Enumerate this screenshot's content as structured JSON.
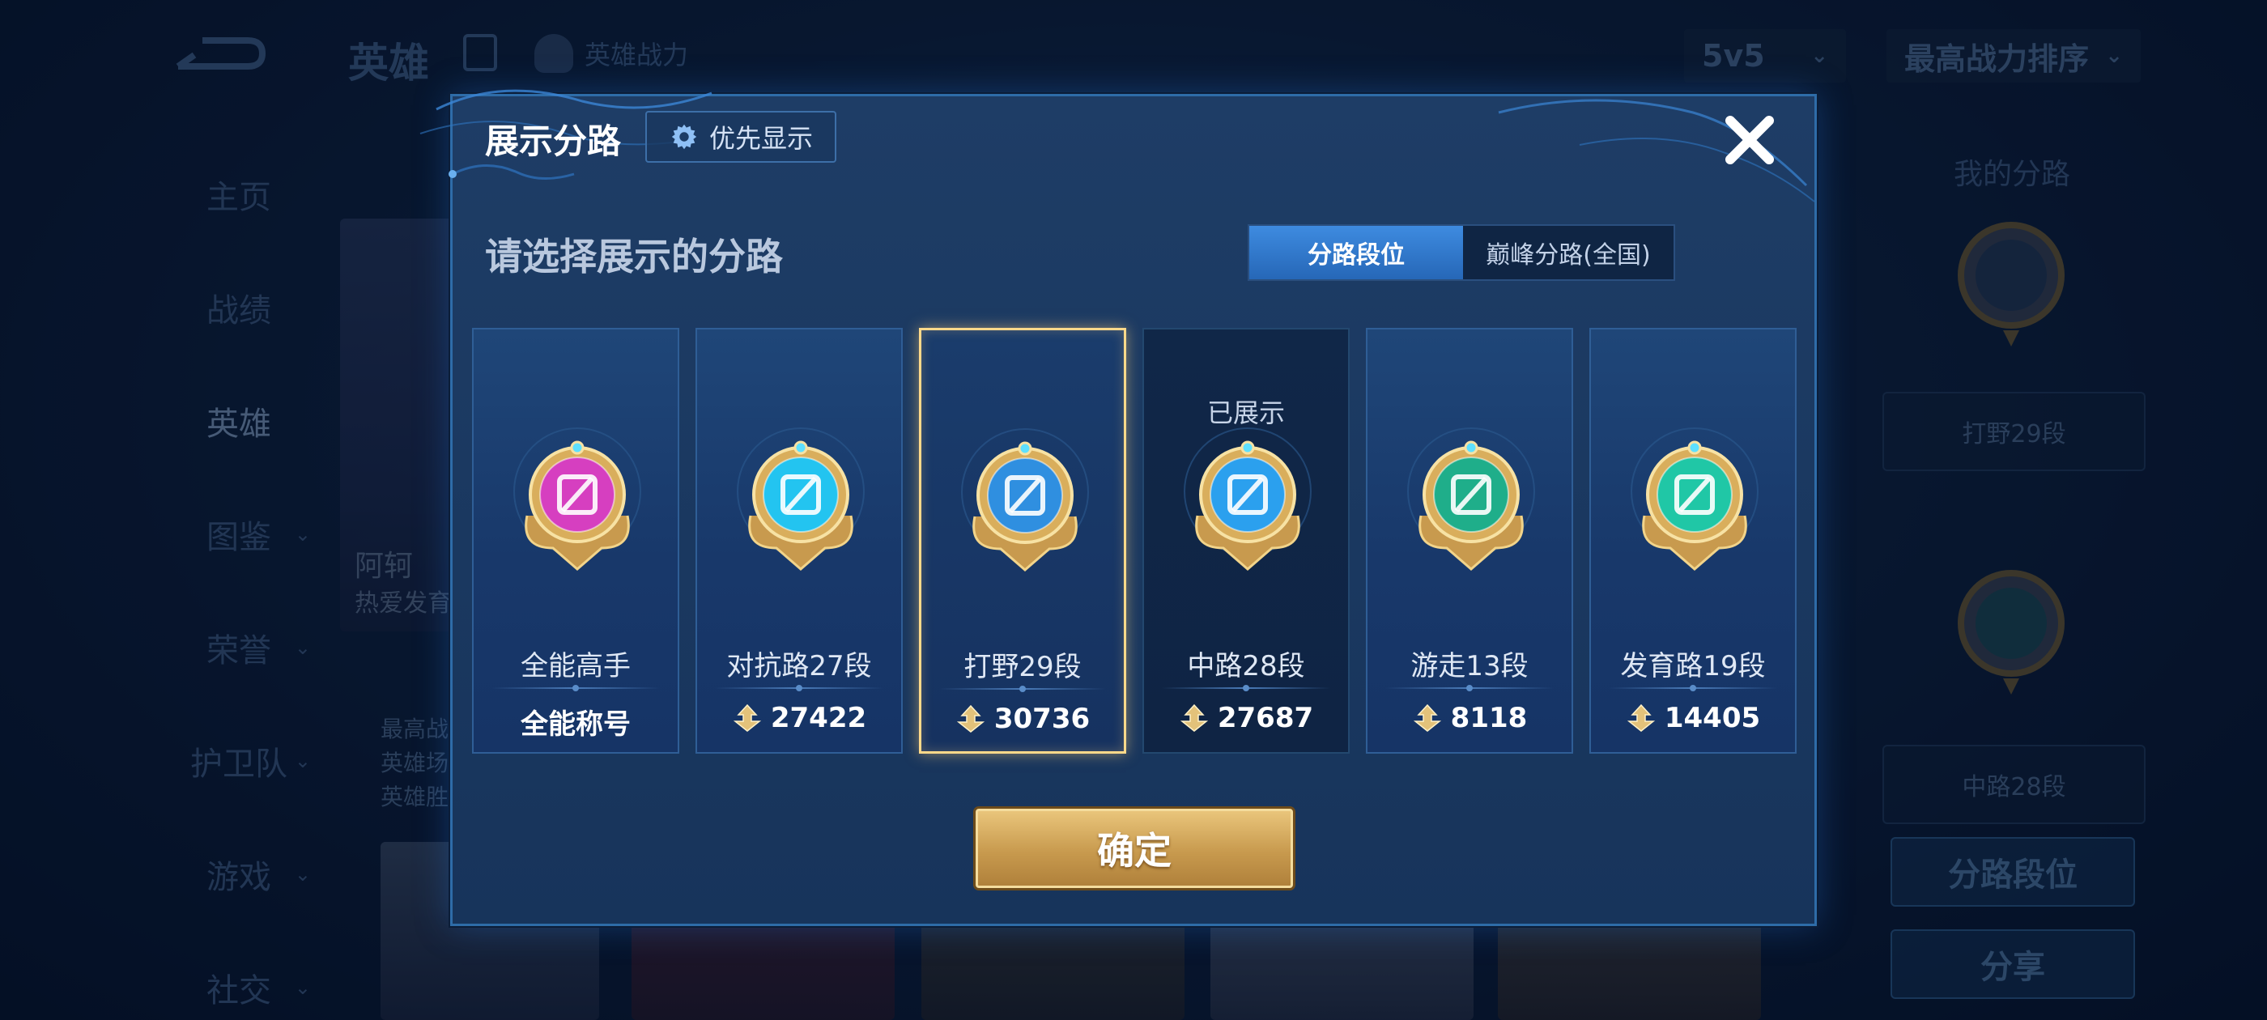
{
  "background": {
    "title": "英雄",
    "power_label": "英雄战力",
    "mode_select": "5v5",
    "sort_select": "最高战力排序",
    "nav": [
      {
        "label": "主页",
        "has_chevron": false,
        "active": false
      },
      {
        "label": "战绩",
        "has_chevron": false,
        "active": false
      },
      {
        "label": "英雄",
        "has_chevron": false,
        "active": true
      },
      {
        "label": "图鉴",
        "has_chevron": true,
        "active": false
      },
      {
        "label": "荣誉",
        "has_chevron": true,
        "active": false
      },
      {
        "label": "护卫队",
        "has_chevron": true,
        "active": false
      },
      {
        "label": "游戏",
        "has_chevron": true,
        "active": false
      },
      {
        "label": "社交",
        "has_chevron": true,
        "active": false
      }
    ],
    "hero_card_name": "阿轲",
    "hero_card_sub": "热爱发育",
    "left_stats": [
      "最高战",
      "英雄场",
      "英雄胜"
    ],
    "right_panel": {
      "title": "我的分路",
      "lane1": "打野29段",
      "lane2": "中路28段",
      "btn_lane_rank": "分路段位",
      "btn_share": "分享"
    }
  },
  "modal": {
    "title": "展示分路",
    "priority_label": "优先显示",
    "subtitle": "请选择展示的分路",
    "toggle": {
      "active": "分路段位",
      "inactive": "巅峰分路(全国)"
    },
    "confirm_label": "确定",
    "cards": [
      {
        "lane": "全能高手",
        "value": "全能称号",
        "shown": "",
        "badge": "all-rounder-badge-icon",
        "color": "#d63fc0",
        "show_power": false
      },
      {
        "lane": "对抗路27段",
        "value": "27422",
        "shown": "",
        "badge": "clash-lane-badge-icon",
        "color": "#23c4f0",
        "show_power": true
      },
      {
        "lane": "打野29段",
        "value": "30736",
        "shown": "",
        "badge": "jungle-badge-icon",
        "color": "#2f8fe0",
        "show_power": true
      },
      {
        "lane": "中路28段",
        "value": "27687",
        "shown": "已展示",
        "badge": "mid-lane-badge-icon",
        "color": "#2ba0ee",
        "show_power": true
      },
      {
        "lane": "游走13段",
        "value": "8118",
        "shown": "",
        "badge": "roam-badge-icon",
        "color": "#1fae8a",
        "show_power": true
      },
      {
        "lane": "发育路19段",
        "value": "14405",
        "shown": "",
        "badge": "farm-lane-badge-icon",
        "color": "#20c7a6",
        "show_power": true
      }
    ],
    "selected_index": 2
  }
}
